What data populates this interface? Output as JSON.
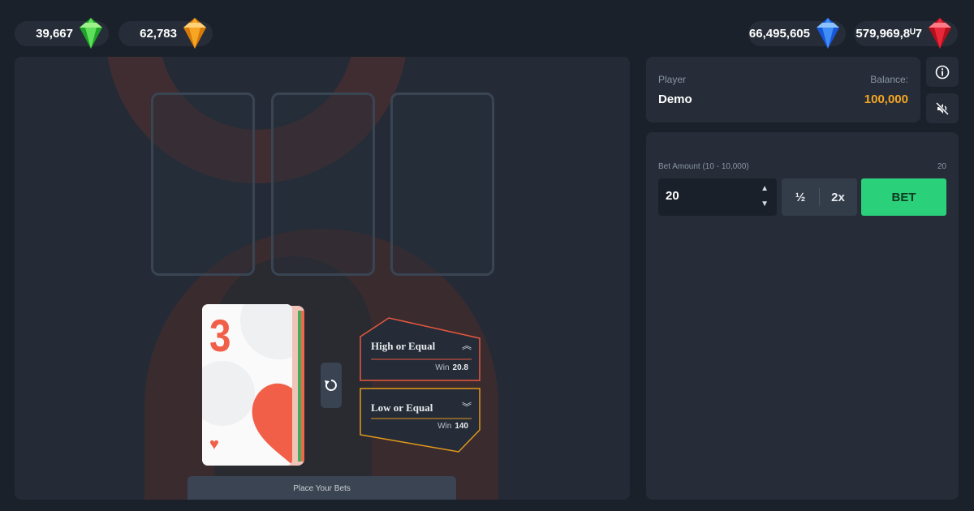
{
  "gems": {
    "green": "39,667",
    "orange": "62,783",
    "blue": "66,495,605",
    "red": "579,969,8ᵁ7"
  },
  "colors": {
    "accent_green": "#2bd17a",
    "balance_orange": "#f5a623",
    "hi_option": "#e8583e",
    "lo_option": "#e39a1c",
    "card_red": "#f15f48"
  },
  "game": {
    "card": {
      "rank": "3",
      "suit": "heart"
    },
    "high_option": {
      "label": "High or Equal",
      "win_label": "Win",
      "win_value": "20.8",
      "icon": "double-chevron-up-icon"
    },
    "low_option": {
      "label": "Low or Equal",
      "win_label": "Win",
      "win_value": "140",
      "icon": "double-chevron-down-icon"
    },
    "status": "Place Your Bets"
  },
  "player": {
    "label": "Player",
    "name": "Demo",
    "balance_label": "Balance:",
    "balance": "100,000"
  },
  "bet": {
    "amount_label": "Bet Amount (10 - 10,000)",
    "amount_right": "20",
    "amount_value": "20",
    "half_label": "½",
    "double_label": "2x",
    "bet_label": "BET"
  }
}
